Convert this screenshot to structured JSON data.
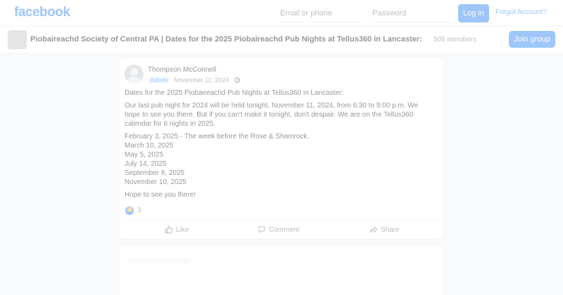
{
  "header": {
    "logo": "facebook",
    "email_placeholder": "Email or phone",
    "password_placeholder": "Password",
    "login_label": "Log in",
    "forgot_label": "Forgot Account?"
  },
  "group": {
    "title": "Piobaireachd Society of Central PA | Dates for the 2025 Piobaireachd Pub Nights at Tellus360 in Lancaster:",
    "members": "506 members",
    "join_label": "Join group"
  },
  "post": {
    "author": "Thompson McConnell",
    "badge": "Admin",
    "date": "November 11, 2024",
    "intro": "Dates for the 2025 Piobaireachd Pub Nights at Tellus360 in Lancaster:",
    "paragraph": "Our last pub night for 2024 will be held tonight, November 11, 2024, from 6:30 to 9:00 p.m.  We hope to see you there.  But if you can't make it tonight, don't despair.  We are on the Tellus360 calendar for 6 nights in 2025.",
    "dates": [
      "February 3, 2025 - The week before the Rose & Shamrock.",
      "March 10, 2025",
      "May 5, 2025",
      "July 14, 2025",
      "September 8, 2025",
      "November 10, 2025"
    ],
    "closing": "Hope to see you there!",
    "reaction_count": "3",
    "actions": {
      "like": "Like",
      "comment": "Comment",
      "share": "Share"
    }
  },
  "colors": {
    "brand": "#1877f2",
    "background": "#f0f2f5",
    "secondary_text": "#65676b"
  }
}
